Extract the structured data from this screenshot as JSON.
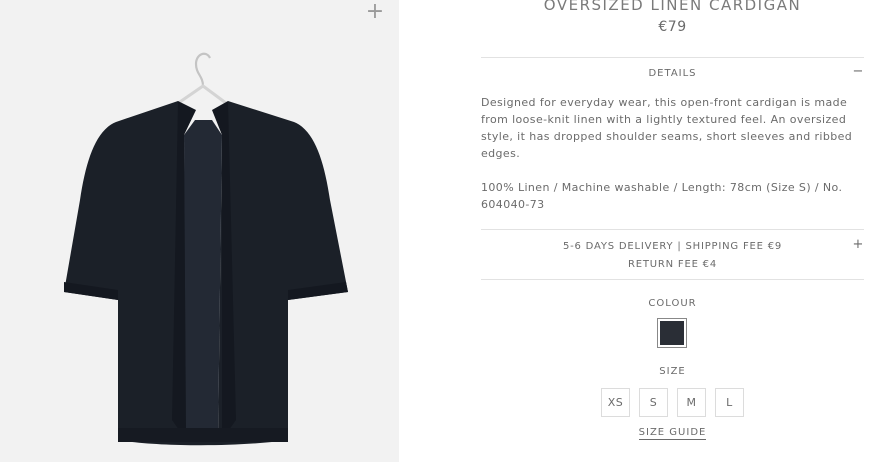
{
  "product": {
    "title": "OVERSIZED LINEN CARDIGAN",
    "price": "€79"
  },
  "image": {
    "zoom_icon": "plus-icon",
    "garment_color": "#1b2028"
  },
  "details": {
    "heading": "DETAILS",
    "toggle": "−",
    "description": "Designed for everyday wear, this open-front cardigan is made from loose-knit linen with a lightly textured feel. An oversized style, it has dropped shoulder seams, short sleeves and ribbed edges.",
    "composition": "100% Linen / Machine washable / Length: 78cm (Size S) / No. 604040-73"
  },
  "delivery": {
    "line1": "5-6 DAYS DELIVERY | SHIPPING FEE €9",
    "line2": "RETURN FEE €4",
    "toggle": "+"
  },
  "colour": {
    "heading": "COLOUR",
    "selected_swatch": "#2a2e36"
  },
  "size": {
    "heading": "SIZE",
    "options": [
      "XS",
      "S",
      "M",
      "L"
    ],
    "guide_label": "SIZE GUIDE"
  }
}
